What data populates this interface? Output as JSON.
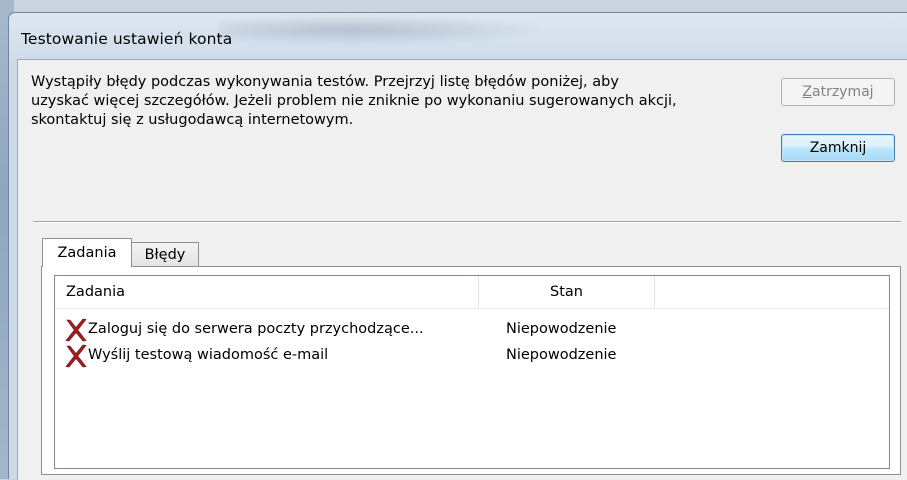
{
  "window": {
    "title": "Testowanie ustawień konta"
  },
  "message": "Wystąpiły błędy podczas wykonywania testów. Przejrzyj listę błędów poniżej, aby\nuzyskać więcej szczegółów. Jeżeli problem nie zniknie po wykonaniu sugerowanych akcji,\nskontaktuj się z usługodawcą internetowym.",
  "buttons": {
    "stop_mnemonic": "Z",
    "stop_rest": "atrzymaj",
    "close_label": "Zamknij"
  },
  "tabs": [
    {
      "label": "Zadania",
      "active": true
    },
    {
      "label": "Błędy",
      "active": false
    }
  ],
  "list": {
    "columns": [
      "Zadania",
      "Stan",
      ""
    ],
    "rows": [
      {
        "task": "Zaloguj się do serwera poczty przychodzące...",
        "state": "Niepowodzenie",
        "icon": "error-x-icon"
      },
      {
        "task": "Wyślij testową wiadomość e-mail",
        "state": "Niepowodzenie",
        "icon": "error-x-icon"
      }
    ]
  },
  "colors": {
    "error_icon": "#a51d22",
    "default_button_border": "#3c7fb1"
  }
}
